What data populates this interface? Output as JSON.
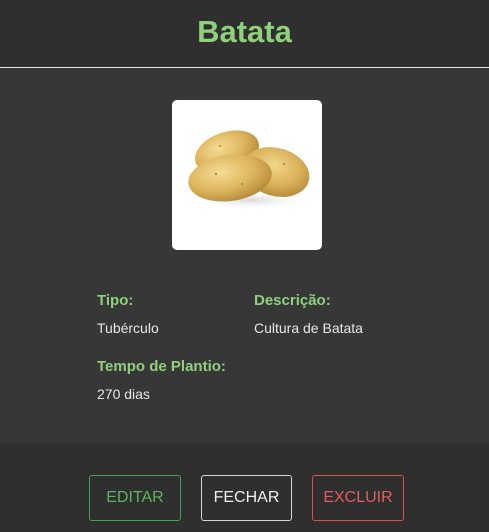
{
  "header": {
    "title": "Batata"
  },
  "image": {
    "subject": "potatoes-photo"
  },
  "details": {
    "tipo_label": "Tipo:",
    "tipo_value": "Tubérculo",
    "descricao_label": "Descrição:",
    "descricao_value": "Cultura de Batata",
    "tempo_label": "Tempo de Plantio:",
    "tempo_value": "270 dias"
  },
  "actions": {
    "edit_label": "EDITAR",
    "close_label": "FECHAR",
    "delete_label": "EXCLUIR"
  },
  "colors": {
    "accent": "#8fd07c",
    "edit": "#5fb35f",
    "delete": "#e35d5a",
    "background": "#373737",
    "header_footer": "#2f2f2f"
  }
}
